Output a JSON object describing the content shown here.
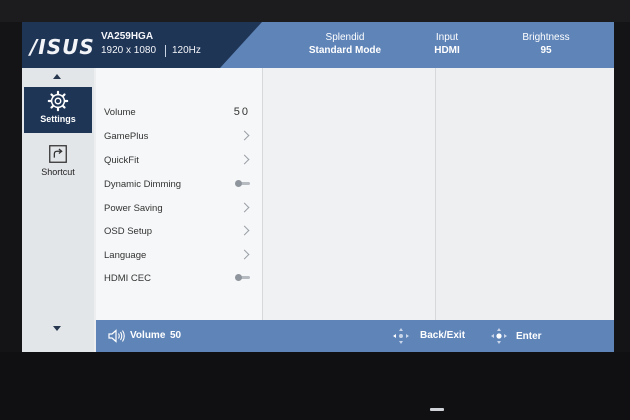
{
  "header": {
    "logo": "/ISUS",
    "model": "VA259HGA",
    "resolution": "1920 x 1080",
    "refresh": "120Hz",
    "splendid": {
      "label": "Splendid",
      "value": "Standard Mode"
    },
    "input": {
      "label": "Input",
      "value": "HDMI"
    },
    "brightness": {
      "label": "Brightness",
      "value": "95"
    }
  },
  "sidebar": {
    "items": [
      {
        "label": "Settings",
        "icon": "gear-icon",
        "active": true
      },
      {
        "label": "Shortcut",
        "icon": "shortcut-icon",
        "active": false
      }
    ]
  },
  "menu": {
    "items": [
      {
        "label": "Volume",
        "value": "50",
        "control": "value"
      },
      {
        "label": "GamePlus",
        "control": "chevron"
      },
      {
        "label": "QuickFit",
        "control": "chevron"
      },
      {
        "label": "Dynamic Dimming",
        "control": "toggle"
      },
      {
        "label": "Power Saving",
        "control": "chevron"
      },
      {
        "label": "OSD Setup",
        "control": "chevron"
      },
      {
        "label": "Language",
        "control": "chevron"
      },
      {
        "label": "HDMI CEC",
        "control": "toggle"
      }
    ]
  },
  "footer": {
    "volume_label": "Volume",
    "volume_value": "50",
    "back_label": "Back/Exit",
    "enter_label": "Enter"
  },
  "colors": {
    "header_dark": "#1f3556",
    "header_blue": "#5f84b8",
    "panel_bg": "#eceef0"
  }
}
